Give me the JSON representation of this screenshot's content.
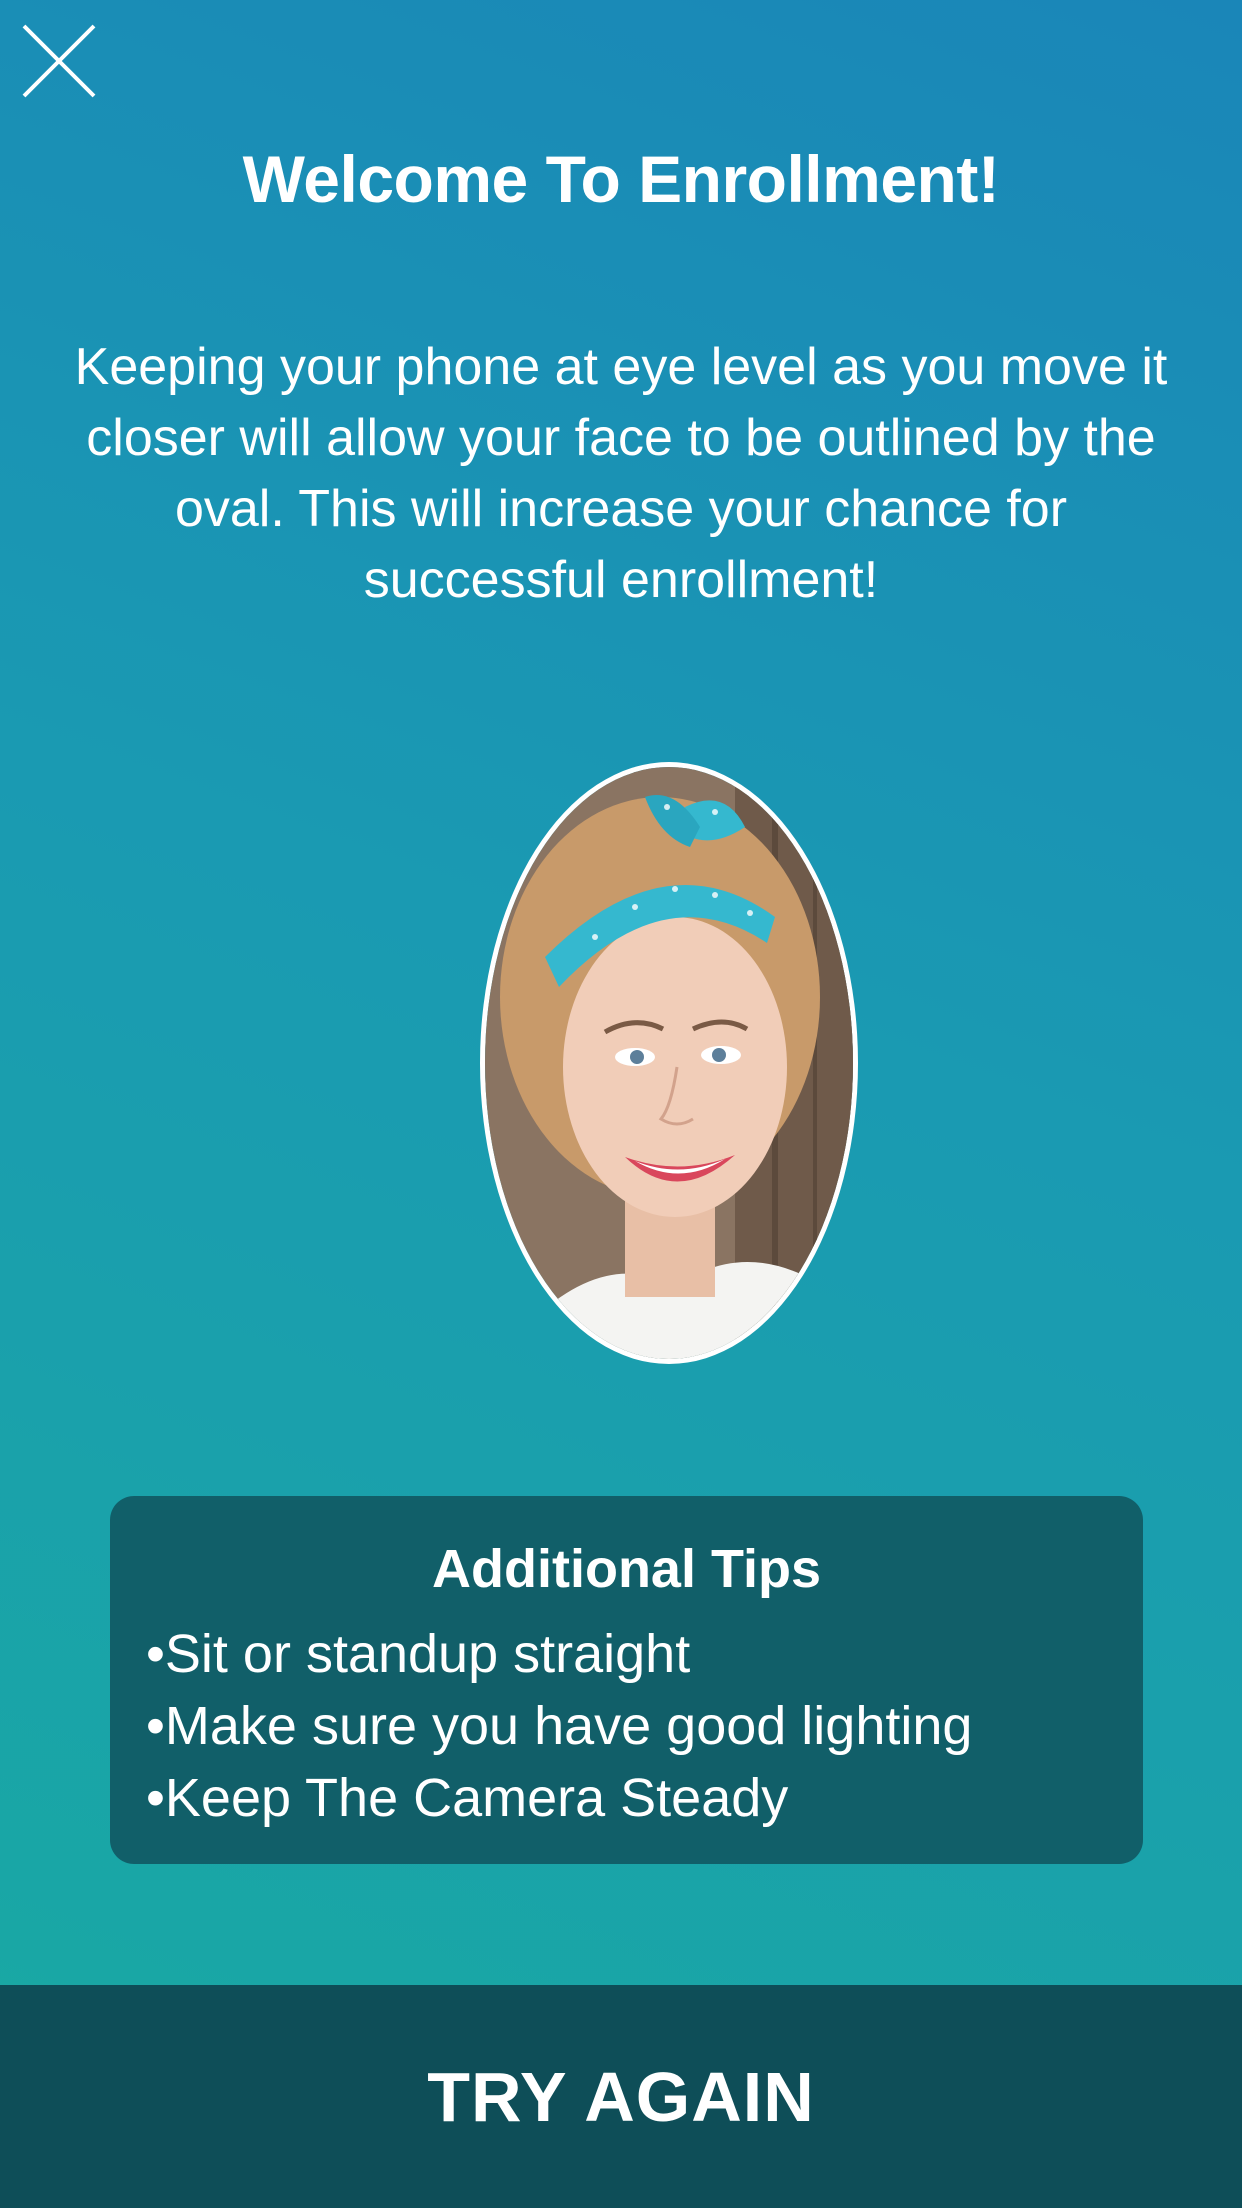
{
  "header": {
    "close_icon": "close-icon",
    "title": "Welcome To Enrollment!"
  },
  "instructions": {
    "text": "Keeping your phone at eye level as you move it closer will allow your face to be outlined by the oval. This will increase your chance for successful enrollment!"
  },
  "face_preview": {
    "image": "smiling-woman-with-turquoise-headband-photo"
  },
  "tips": {
    "title": "Additional Tips",
    "items": [
      "Sit or standup straight",
      "Make sure you have good lighting",
      "Keep The Camera Steady"
    ]
  },
  "footer": {
    "button_label": "TRY AGAIN"
  },
  "colors": {
    "gradient_top": "#1a86b8",
    "gradient_bottom": "#19aaa2",
    "card_background": "#115f69",
    "footer_background": "#0e4e58",
    "text": "#ffffff"
  }
}
